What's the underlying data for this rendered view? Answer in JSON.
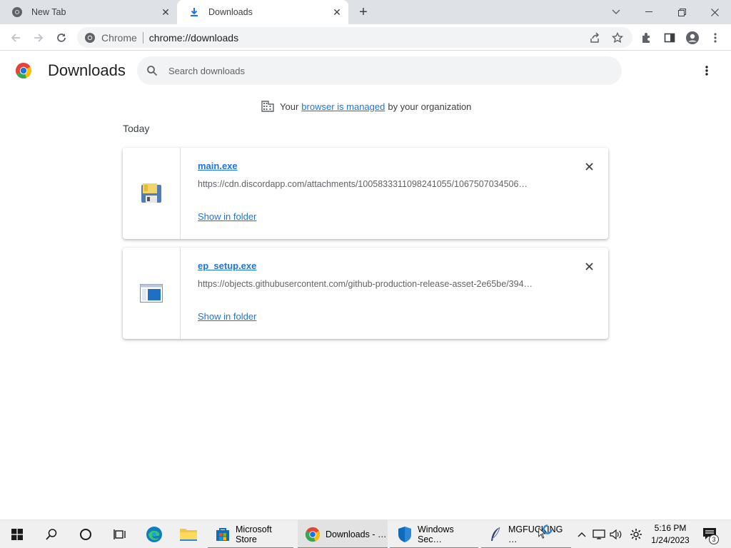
{
  "colors": {
    "accent": "#1a73e8",
    "tabbar_bg": "#dee1e6",
    "taskbar_bg": "#f0f0f0"
  },
  "tabs": [
    {
      "title": "New Tab",
      "icon": "chrome-icon",
      "active": false
    },
    {
      "title": "Downloads",
      "icon": "download-icon",
      "active": true
    }
  ],
  "omnibox": {
    "site_chip": "Chrome",
    "url": "chrome://downloads"
  },
  "page": {
    "title": "Downloads",
    "search_placeholder": "Search downloads",
    "managed": {
      "prefix": "Your",
      "link": "browser is managed",
      "suffix": "by your organization"
    },
    "section": "Today"
  },
  "downloads": [
    {
      "filename": "main.exe",
      "url": "https://cdn.discordapp.com/attachments/1005833311098241055/1067507034506…",
      "action": "Show in folder",
      "icon": "floppy-file-icon"
    },
    {
      "filename": "ep_setup.exe",
      "url": "https://objects.githubusercontent.com/github-production-release-asset-2e65be/394…",
      "action": "Show in folder",
      "icon": "window-app-icon"
    }
  ],
  "taskbar": {
    "apps": [
      {
        "label": "Microsoft Store",
        "icon": "store-icon"
      },
      {
        "label": "Downloads - …",
        "icon": "chrome-icon"
      },
      {
        "label": "Windows Sec…",
        "icon": "shield-icon"
      },
      {
        "label": "MGFUCKING …",
        "icon": "feather-icon"
      }
    ],
    "clock_time": "5:16 PM",
    "clock_date": "1/24/2023",
    "notification_count": "3"
  }
}
